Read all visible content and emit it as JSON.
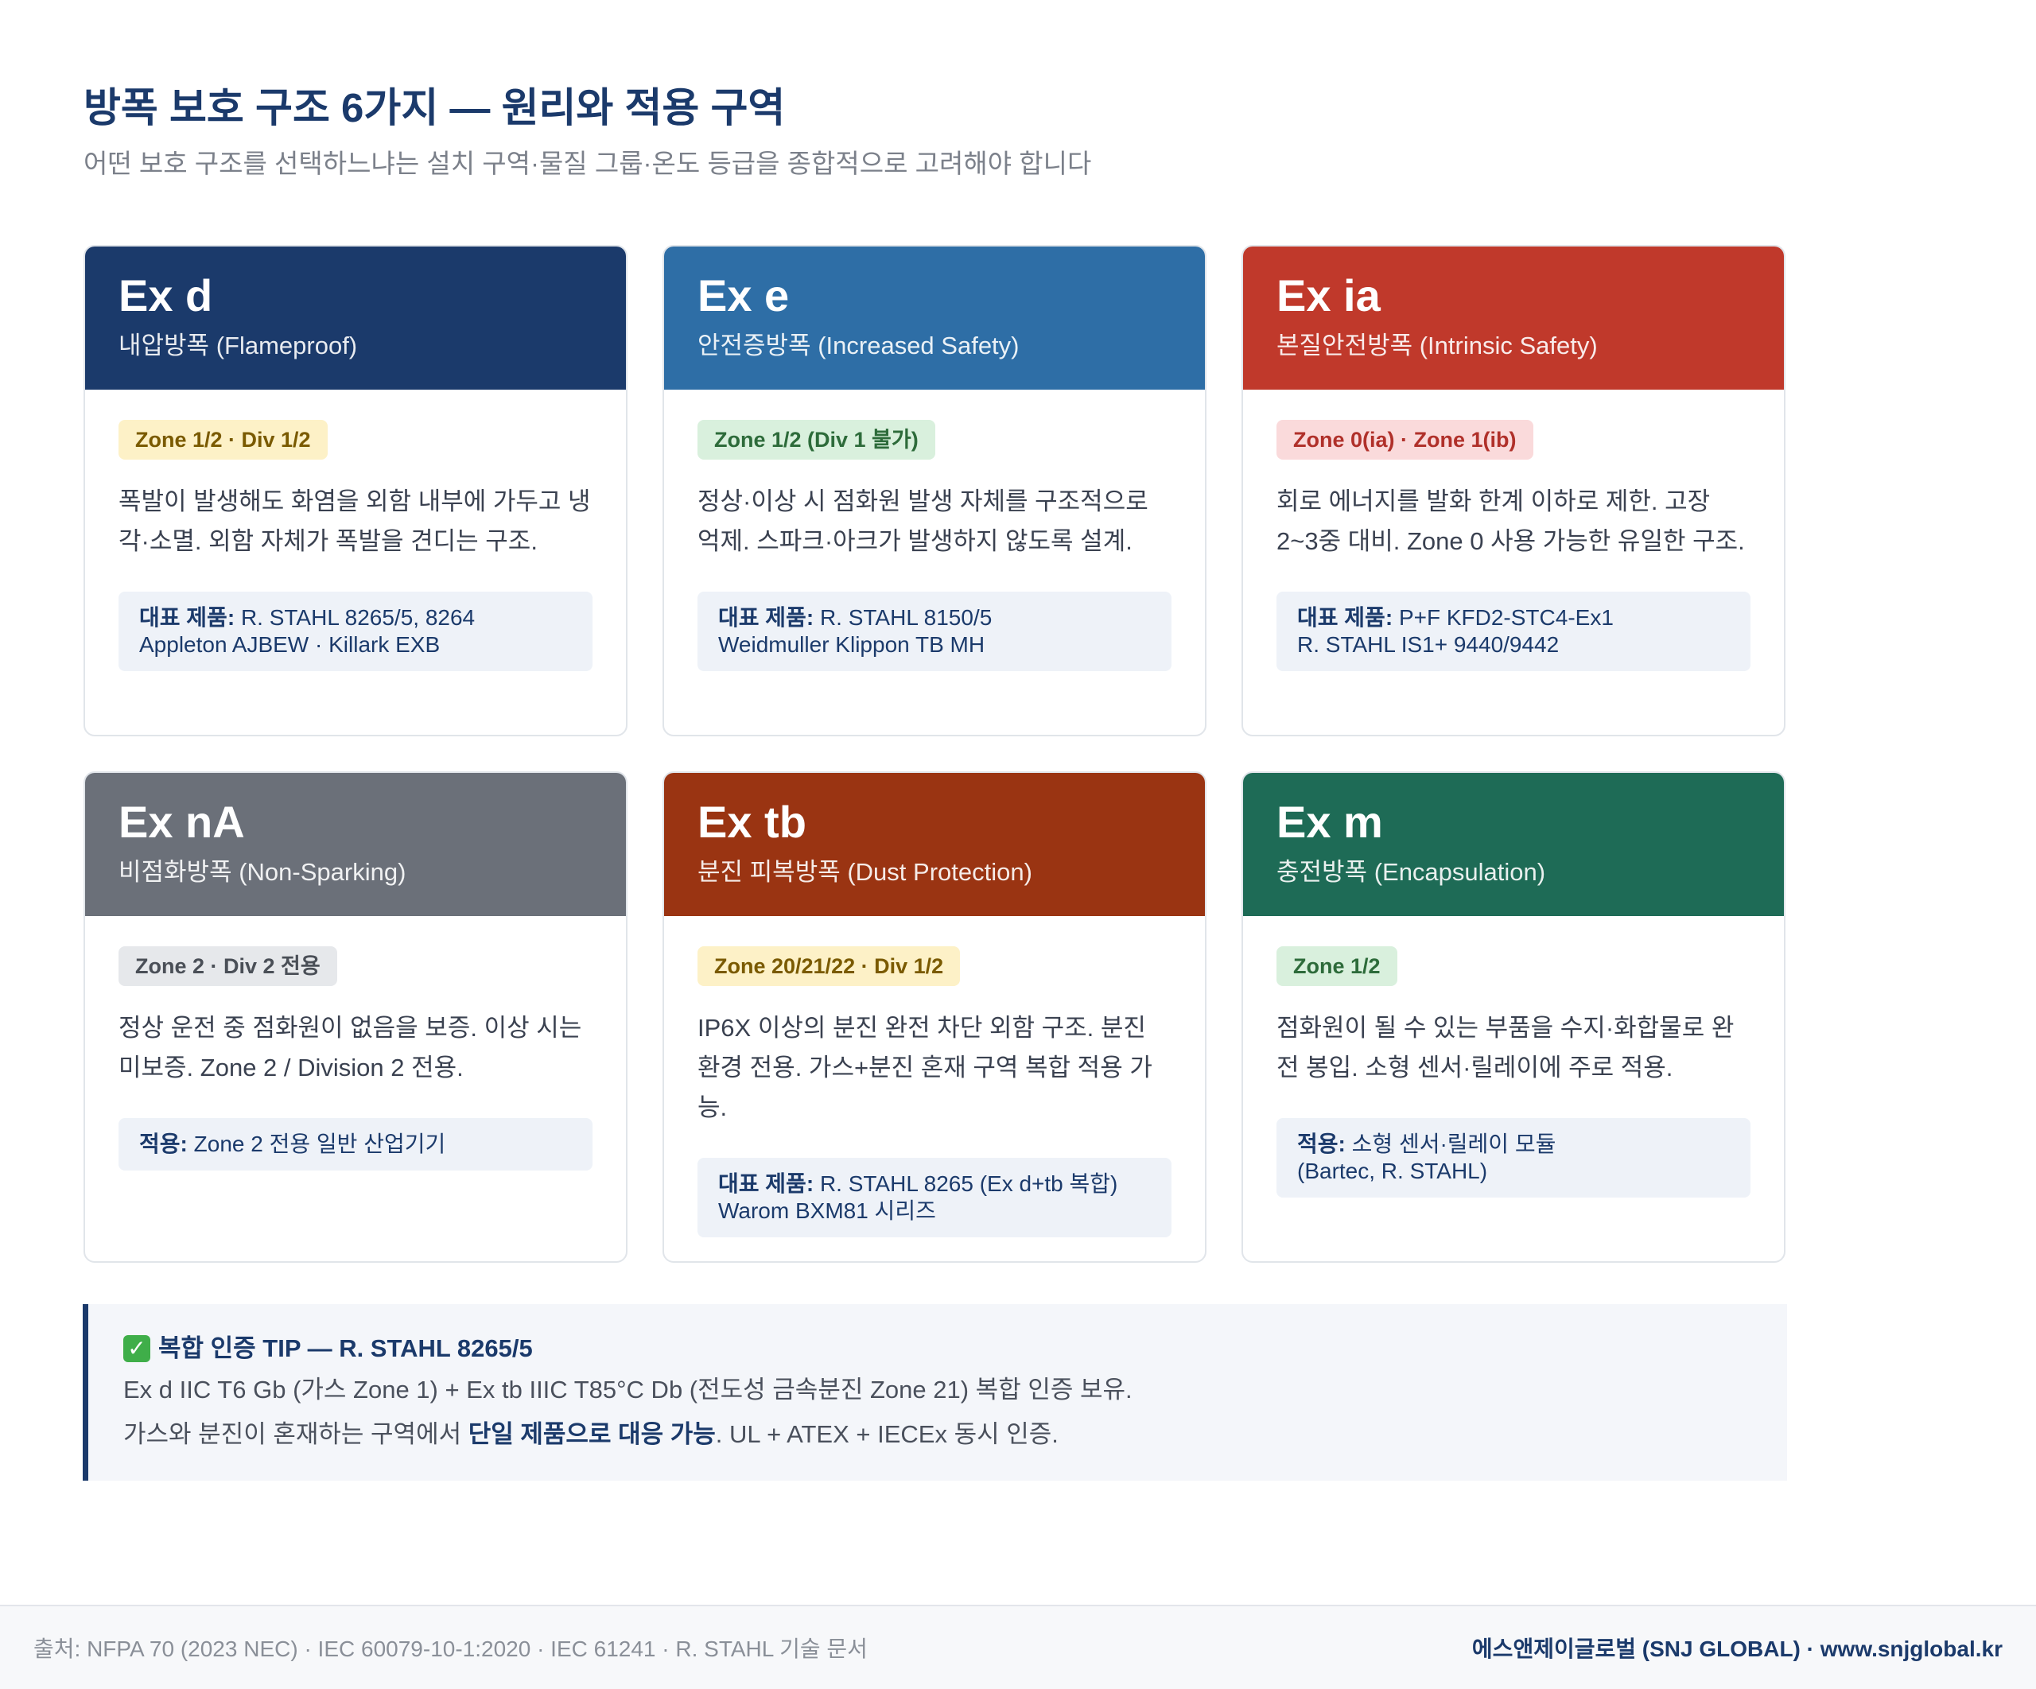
{
  "header": {
    "title": "방폭 보호 구조 6가지 — 원리와 적용 구역",
    "subtitle": "어떤 보호 구조를 선택하느냐는 설치 구역·물질 그룹·온도 등급을 종합적으로 고려해야 합니다"
  },
  "cards": [
    {
      "code": "Ex d",
      "name": "내압방폭 (Flameproof)",
      "header_color": "#1b3a6b",
      "badge": "Zone 1/2 · Div 1/2",
      "badge_bg": "#fdf1c7",
      "badge_fg": "#7a5a00",
      "description": "폭발이 발생해도 화염을 외함 내부에 가두고 냉각·소멸. 외함 자체가 폭발을 견디는 구조.",
      "box_label": "대표 제품:",
      "box_line1": "R. STAHL 8265/5, 8264",
      "box_line2": "Appleton AJBEW · Killark EXB"
    },
    {
      "code": "Ex e",
      "name": "안전증방폭 (Increased Safety)",
      "header_color": "#2e6ea6",
      "badge": "Zone 1/2 (Div 1 불가)",
      "badge_bg": "#d9f0dd",
      "badge_fg": "#2d6b3a",
      "description": "정상·이상 시 점화원 발생 자체를 구조적으로 억제. 스파크·아크가 발생하지 않도록 설계.",
      "box_label": "대표 제품:",
      "box_line1": "R. STAHL 8150/5",
      "box_line2": "Weidmuller Klippon TB MH"
    },
    {
      "code": "Ex ia",
      "name": "본질안전방폭 (Intrinsic Safety)",
      "header_color": "#c0392b",
      "badge": "Zone 0(ia) · Zone 1(ib)",
      "badge_bg": "#fadadb",
      "badge_fg": "#b0302a",
      "description": "회로 에너지를 발화 한계 이하로 제한. 고장 2~3중 대비. Zone 0 사용 가능한 유일한 구조.",
      "box_label": "대표 제품:",
      "box_line1": "P+F KFD2-STC4-Ex1",
      "box_line2": "R. STAHL IS1+ 9440/9442"
    },
    {
      "code": "Ex nA",
      "name": "비점화방폭 (Non-Sparking)",
      "header_color": "#6b7079",
      "badge": "Zone 2 · Div 2 전용",
      "badge_bg": "#e6e8eb",
      "badge_fg": "#4a4f57",
      "description": "정상 운전 중 점화원이 없음을 보증. 이상 시는 미보증. Zone 2 / Division 2 전용.",
      "box_label": "적용:",
      "box_line1": "Zone 2 전용 일반 산업기기",
      "box_line2": ""
    },
    {
      "code": "Ex tb",
      "name": "분진 피복방폭 (Dust Protection)",
      "header_color": "#9a3412",
      "badge": "Zone 20/21/22 · Div 1/2",
      "badge_bg": "#fdf1c7",
      "badge_fg": "#7a5a00",
      "description": "IP6X 이상의 분진 완전 차단 외함 구조. 분진 환경 전용. 가스+분진 혼재 구역 복합 적용 가능.",
      "box_label": "대표 제품:",
      "box_line1": "R. STAHL 8265 (Ex d+tb 복합)",
      "box_line2": "Warom BXM81 시리즈"
    },
    {
      "code": "Ex m",
      "name": "충전방폭 (Encapsulation)",
      "header_color": "#1e6b56",
      "badge": "Zone 1/2",
      "badge_bg": "#d9f0dd",
      "badge_fg": "#2d6b3a",
      "description": "점화원이 될 수 있는 부품을 수지·화합물로 완전 봉입. 소형 센서·릴레이에 주로 적용.",
      "box_label": "적용:",
      "box_line1": "소형 센서·릴레이 모듈",
      "box_line2": "(Bartec, R. STAHL)"
    }
  ],
  "tip": {
    "title": "복합 인증 TIP — R. STAHL 8265/5",
    "line1": "Ex d IIC T6 Gb (가스 Zone 1) + Ex tb IIIC T85°C Db (전도성 금속분진 Zone 21) 복합 인증 보유.",
    "line2_pre": "가스와 분진이 혼재하는 구역에서 ",
    "line2_strong": "단일 제품으로 대응 가능",
    "line2_post": ". UL + ATEX + IECEx 동시 인증."
  },
  "footer": {
    "source": "출처: NFPA 70 (2023 NEC) · IEC 60079-10-1:2020 · IEC 61241 · R. STAHL 기술 문서",
    "brand": "에스앤제이글로벌 (SNJ GLOBAL) · www.snjglobal.kr"
  }
}
